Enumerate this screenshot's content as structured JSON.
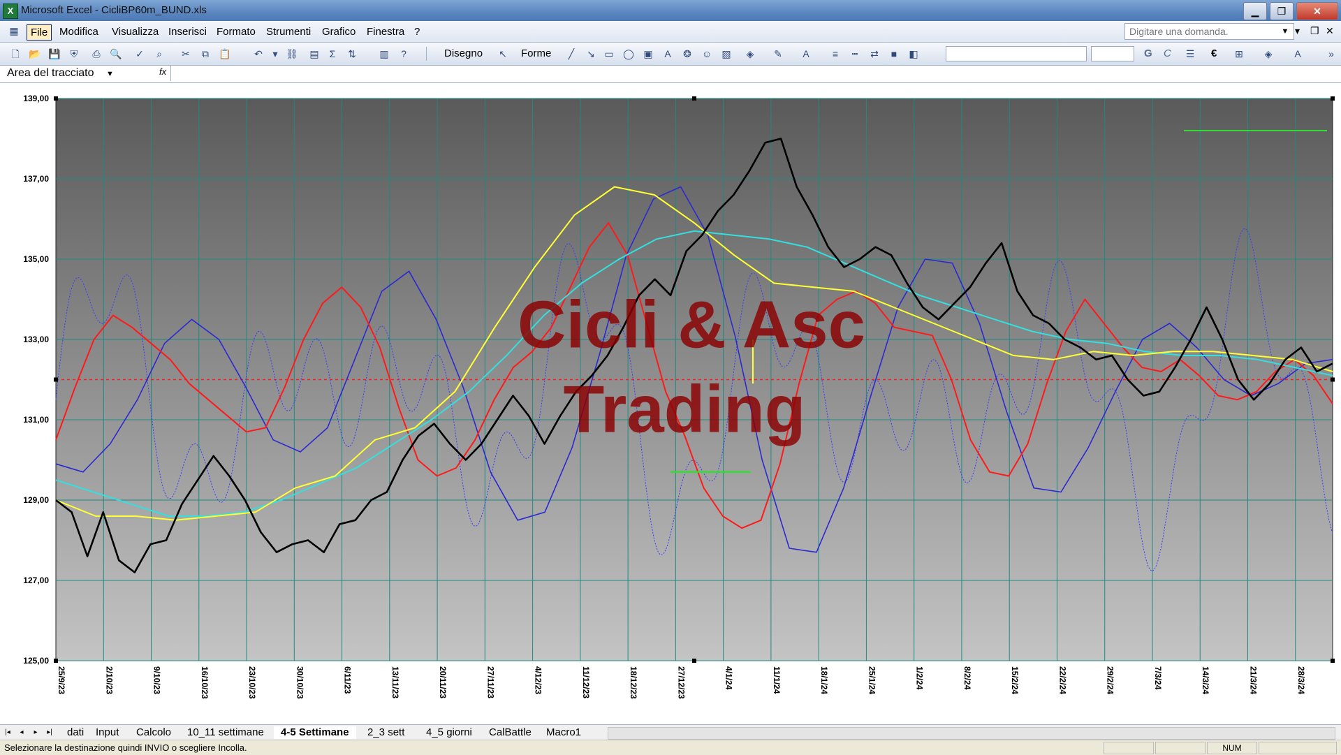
{
  "window": {
    "title": "Microsoft Excel - CicliBP60m_BUND.xls",
    "minimize_glyph": "▁",
    "restore_glyph": "❐",
    "close_glyph": "✕"
  },
  "menu": {
    "items": [
      "File",
      "Modifica",
      "Visualizza",
      "Inserisci",
      "Formato",
      "Strumenti",
      "Grafico",
      "Finestra",
      "?"
    ],
    "help_placeholder": "Digitare una domanda.",
    "doc_minimize": "▾",
    "doc_restore": "❐",
    "doc_close": "✕"
  },
  "toolbar": {
    "drawing_label": "Disegno",
    "shapes_label": "Forme",
    "bold_label": "G",
    "italic_label": "C",
    "euro_label": "€"
  },
  "formula_bar": {
    "name_box": "Area del tracciato",
    "fx_label": "fx"
  },
  "chart_data": {
    "type": "line",
    "watermark": [
      "Cicli & Asc",
      "Trading"
    ],
    "ylim": [
      125,
      139
    ],
    "y_ticks": [
      "125,00",
      "127,00",
      "129,00",
      "131,00",
      "133,00",
      "135,00",
      "137,00",
      "139,00"
    ],
    "x_ticks": [
      "25/9/23",
      "2/10/23",
      "9/10/23",
      "16/10/23",
      "23/10/23",
      "30/10/23",
      "6/11/23",
      "13/11/23",
      "20/11/23",
      "27/11/23",
      "4/12/23",
      "11/12/23",
      "18/12/23",
      "27/12/23",
      "4/1/24",
      "11/1/24",
      "18/1/24",
      "25/1/24",
      "1/2/24",
      "8/2/24",
      "15/2/24",
      "22/2/24",
      "29/2/24",
      "7/3/24",
      "14/3/24",
      "21/3/24",
      "28/3/24"
    ],
    "reference_line": 132.0,
    "colors": {
      "plot_top": "#5a5a5a",
      "plot_bottom": "#c4c4c4",
      "grid": "#1f8a80",
      "price": "#000000",
      "red_cycle": "#ff1a1a",
      "blue_cycle": "#2a2ad0",
      "blue_dotted": "#3a3aff",
      "yellow_avg": "#ffff33",
      "cyan_avg": "#33e0e0",
      "reference": "#ff1a1a",
      "marker_green": "#33dd33",
      "watermark": "#8b0000"
    },
    "series": [
      {
        "values": [
          129.0,
          128.7,
          127.6,
          128.7,
          127.5,
          127.2,
          127.9,
          128.0,
          128.9,
          129.5,
          130.1,
          129.6,
          129.0,
          128.2,
          127.7,
          127.9,
          128.0,
          127.7,
          128.4,
          128.5,
          129.0,
          129.2,
          130.0,
          130.6,
          130.9,
          130.4,
          130.0,
          130.4,
          131.0,
          131.6,
          131.1,
          130.4,
          131.1,
          131.7,
          132.1,
          132.6,
          133.3,
          134.1,
          134.5,
          134.1,
          135.2,
          135.6,
          136.2,
          136.6,
          137.2,
          137.9,
          138.0,
          136.8,
          136.1,
          135.3,
          134.8,
          135.0,
          135.3,
          135.1,
          134.4,
          133.8,
          133.5,
          133.9,
          134.3,
          134.9,
          135.4,
          134.2,
          133.6,
          133.4,
          133.0,
          132.8,
          132.5,
          132.6,
          132.0,
          131.6,
          131.7,
          132.3,
          133.0,
          133.8,
          133.0,
          132.0,
          131.5,
          131.9,
          132.5,
          132.8,
          132.2,
          132.4
        ],
        "color": "price"
      },
      {
        "values": [
          130.5,
          131.8,
          133.0,
          133.6,
          133.3,
          132.9,
          132.5,
          131.9,
          131.5,
          131.1,
          130.7,
          130.8,
          131.8,
          133.0,
          133.9,
          134.3,
          133.8,
          132.8,
          131.3,
          130.0,
          129.6,
          129.8,
          130.5,
          131.5,
          132.3,
          132.7,
          133.3,
          134.3,
          135.3,
          135.9,
          135.1,
          133.4,
          131.7,
          130.6,
          129.3,
          128.6,
          128.3,
          128.5,
          129.9,
          131.9,
          133.6,
          134.0,
          134.2,
          133.9,
          133.3,
          133.2,
          133.1,
          132.0,
          130.5,
          129.7,
          129.6,
          130.4,
          131.9,
          133.2,
          134.0,
          133.4,
          132.8,
          132.3,
          132.2,
          132.5,
          132.1,
          131.6,
          131.5,
          131.7,
          132.2,
          132.5,
          132.1,
          131.4
        ]
      },
      {
        "values": [
          129.9,
          129.7,
          130.4,
          131.5,
          132.9,
          133.5,
          133.0,
          131.8,
          130.5,
          130.2,
          130.8,
          132.5,
          134.2,
          134.7,
          133.5,
          131.8,
          129.7,
          128.5,
          128.7,
          130.3,
          132.6,
          135.1,
          136.5,
          136.8,
          135.6,
          133.1,
          130.0,
          127.8,
          127.7,
          129.3,
          131.6,
          133.8,
          135.0,
          134.9,
          133.4,
          131.2,
          129.3,
          129.2,
          130.3,
          131.7,
          133.0,
          133.4,
          132.8,
          132.0,
          131.6,
          131.9,
          132.4,
          132.5
        ]
      },
      {
        "values": [
          129.5,
          129.2,
          128.9,
          128.6,
          128.6,
          128.7,
          129.0,
          129.4,
          129.8,
          130.4,
          131.0,
          131.7,
          132.6,
          133.6,
          134.4,
          135.0,
          135.5,
          135.7,
          135.6,
          135.5,
          135.3,
          134.9,
          134.5,
          134.1,
          133.8,
          133.5,
          133.2,
          133.0,
          132.9,
          132.7,
          132.6,
          132.6,
          132.5,
          132.3,
          132.1
        ]
      },
      {
        "values": [
          129.0,
          128.6,
          128.6,
          128.5,
          128.6,
          128.7,
          129.3,
          129.6,
          130.5,
          130.8,
          131.7,
          133.3,
          134.8,
          136.1,
          136.8,
          136.6,
          135.9,
          135.1,
          134.4,
          134.3,
          134.2,
          133.8,
          133.4,
          133.0,
          132.6,
          132.5,
          132.7,
          132.6,
          132.7,
          132.7,
          132.6,
          132.5,
          132.2
        ]
      }
    ]
  },
  "sheet_tabs": {
    "items": [
      "dati",
      "Input",
      "Calcolo",
      "10_11 settimane",
      "4-5 Settimane",
      "2_3 sett",
      "4_5 giorni",
      "CalBattle",
      "Macro1"
    ],
    "active": "4-5 Settimane",
    "nav_first": "|◂",
    "nav_prev": "◂",
    "nav_next": "▸",
    "nav_last": "▸|"
  },
  "status": {
    "message": "Selezionare la destinazione quindi INVIO o scegliere Incolla.",
    "num": "NUM"
  }
}
